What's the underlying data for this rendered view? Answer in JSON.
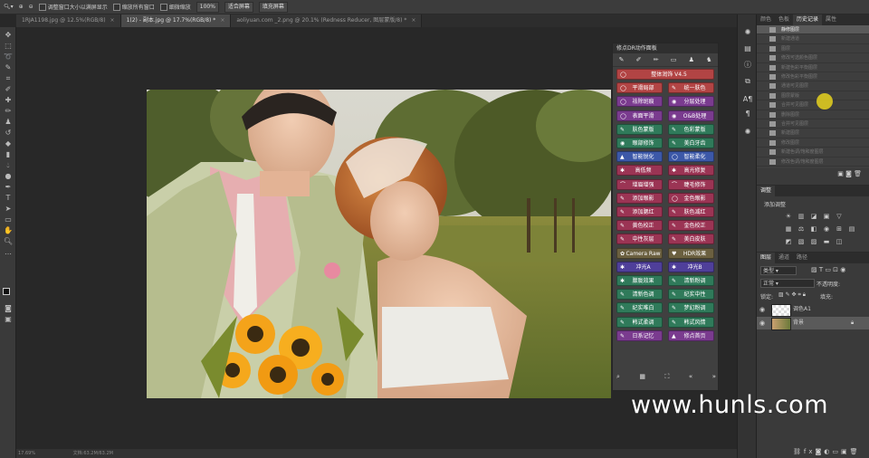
{
  "options_bar": {
    "chk1_label": "调整窗口大小以满屏显示",
    "btn1": "缩放所有窗口",
    "btn2": "细微缩放",
    "zoom": "100%",
    "fit_btn": "适合屏幕",
    "fill_btn": "填充屏幕"
  },
  "tabs": [
    {
      "label": "1RJA1198.jpg @ 12.5%(RGB/8)"
    },
    {
      "label": "1(2) - 副本.jpg @ 17.7%(RGB/8) *"
    },
    {
      "label": "aoliyuan.com _2.png @ 20.1% (Redness Reducer, 图层蒙版/8) *"
    }
  ],
  "status": {
    "zoom": "17.69%",
    "doc": "文档:63.2M/63.2M"
  },
  "dr_panel": {
    "title": "修点DR动作面板",
    "buttons": [
      {
        "label": "整体润饰",
        "extra": "V4.5",
        "color": "#b24444",
        "icon": "◯"
      },
      {
        "label": "平滑局部",
        "color": "#b24444",
        "icon": "◯"
      },
      {
        "label": "统一肤色",
        "color": "#b24444",
        "icon": "✎"
      },
      {
        "label": "祛除斑痕",
        "color": "#7a3b8f",
        "icon": "◯"
      },
      {
        "label": "分层处理",
        "color": "#7a3b8f",
        "icon": "◉"
      },
      {
        "label": "表面平滑",
        "color": "#7a3b8f",
        "icon": "◯"
      },
      {
        "label": "O&B处理",
        "color": "#7a3b8f",
        "icon": "◉"
      },
      {
        "label": "肤色蒙版",
        "color": "#2f7a5a",
        "icon": "✎"
      },
      {
        "label": "色彩蒙版",
        "color": "#2f7a5a",
        "icon": "✎"
      },
      {
        "label": "眼部修饰",
        "color": "#2f7a5a",
        "icon": "◉"
      },
      {
        "label": "美白牙齿",
        "color": "#2f7a5a",
        "icon": "✎"
      },
      {
        "label": "智能锐化",
        "color": "#3c58a8",
        "icon": "▲"
      },
      {
        "label": "智能柔化",
        "color": "#3c58a8",
        "icon": "◯"
      },
      {
        "label": "高低频",
        "color": "#9b3454",
        "icon": "✱"
      },
      {
        "label": "高光修复",
        "color": "#9b3454",
        "icon": "✱"
      },
      {
        "label": "增眉增强",
        "color": "#9b3454",
        "icon": "⌒"
      },
      {
        "label": "睫毛修饰",
        "color": "#9b3454",
        "icon": "⌒"
      },
      {
        "label": "添加眼影",
        "color": "#9b3454",
        "icon": "✎"
      },
      {
        "label": "金色眼影",
        "color": "#9b3454",
        "icon": "◯"
      },
      {
        "label": "添加腮红",
        "color": "#9b3454",
        "icon": "✎"
      },
      {
        "label": "肤色减红",
        "color": "#9b3454",
        "icon": "✎"
      },
      {
        "label": "黄色校正",
        "color": "#9b3454",
        "icon": "✎"
      },
      {
        "label": "金色校正",
        "color": "#9b3454",
        "icon": "✎"
      },
      {
        "label": "中性灰层",
        "color": "#9b3454",
        "icon": "✎"
      },
      {
        "label": "美白皮肤",
        "color": "#9b3454",
        "icon": "✎"
      },
      {
        "label": "Camera Raw",
        "color": "#6b6040",
        "icon": "✿"
      },
      {
        "label": "HDR效果",
        "color": "#6b6040",
        "icon": "♥"
      },
      {
        "label": "冲光A",
        "color": "#4f3f9a",
        "icon": "✱"
      },
      {
        "label": "冲光B",
        "color": "#4f3f9a",
        "icon": "✱"
      },
      {
        "label": "朦胧效果",
        "color": "#2f7a5a",
        "icon": "✱"
      },
      {
        "label": "清新粉调",
        "color": "#2f7a5a",
        "icon": "✎"
      },
      {
        "label": "清新色调",
        "color": "#2f7a5a",
        "icon": "✎"
      },
      {
        "label": "纪实中性",
        "color": "#2f7a5a",
        "icon": "✎"
      },
      {
        "label": "纪实唯白",
        "color": "#2f7a5a",
        "icon": "✎"
      },
      {
        "label": "梦幻粉调",
        "color": "#2f7a5a",
        "icon": "✎"
      },
      {
        "label": "韩式柔调",
        "color": "#2f7a5a",
        "icon": "✎"
      },
      {
        "label": "韩式风情",
        "color": "#2f7a5a",
        "icon": "✎"
      },
      {
        "label": "日系记忆",
        "color": "#7a3b8f",
        "icon": "✎"
      },
      {
        "label": "修点首页",
        "color": "#7a3b8f",
        "icon": "▲"
      }
    ]
  },
  "right": {
    "top_tabs": [
      "颜色",
      "色板",
      "历史记录",
      "属性"
    ],
    "history": [
      "静修图层",
      "新建通道",
      "图层",
      "修改可选颜色图层",
      "新建色彩平衡图层",
      "修改色彩平衡图层",
      "通道可见图层",
      "图层蒙版",
      "合并可见图层",
      "删除图层",
      "合并可见图层",
      "新建图层",
      "修改图层",
      "新建色调/饱和度图层",
      "修改色调/饱和度图层"
    ],
    "adj_tab": "调整",
    "adj_title": "添加调整",
    "layer_tabs": [
      "图层",
      "通道",
      "路径"
    ],
    "layer_kind": "类型",
    "blend_mode": "正常",
    "opacity_label": "不透明度:",
    "fill_label": "填充:",
    "lock_label": "锁定:",
    "layers": [
      "调色A1",
      "背景"
    ]
  },
  "watermark": "www.hunls.com"
}
